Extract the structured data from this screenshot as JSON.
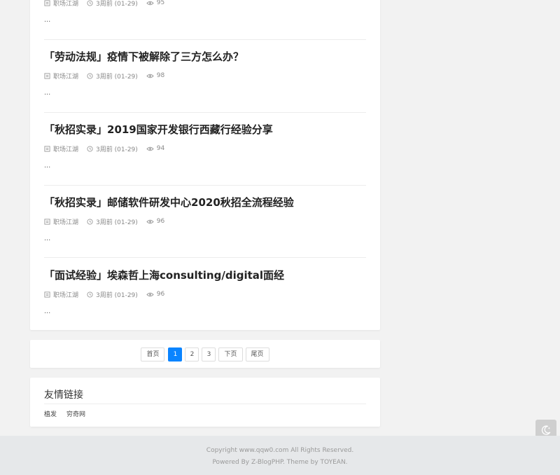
{
  "posts": [
    {
      "title": "",
      "category": "职场江湖",
      "time": "3周前 (01-29)",
      "views": "95",
      "excerpt": "..."
    },
    {
      "title": "「劳动法规」疫情下被解除了三方怎么办？",
      "category": "职场江湖",
      "time": "3周前 (01-29)",
      "views": "98",
      "excerpt": "..."
    },
    {
      "title": "「秋招实录」2019国家开发银行西藏行经验分享",
      "category": "职场江湖",
      "time": "3周前 (01-29)",
      "views": "94",
      "excerpt": "..."
    },
    {
      "title": "「秋招实录」邮储软件研发中心2020秋招全流程经验",
      "category": "职场江湖",
      "time": "3周前 (01-29)",
      "views": "96",
      "excerpt": "..."
    },
    {
      "title": "「面试经验」埃森哲上海consulting/digital面经",
      "category": "职场江湖",
      "time": "3周前 (01-29)",
      "views": "96",
      "excerpt": "..."
    }
  ],
  "pagination": {
    "first": "首页",
    "pages": [
      "1",
      "2",
      "3"
    ],
    "current": "1",
    "next": "下页",
    "last": "尾页"
  },
  "links": {
    "title": "友情链接",
    "items": [
      "植发",
      "穷奇网"
    ]
  },
  "footer": {
    "copyright": "Copyright www.qqw0.com All Rights Reserved.",
    "powered": "Powered By Z-BlogPHP. Theme by TOYEAN."
  },
  "icons": {
    "category": "category-icon",
    "time": "clock-icon",
    "views": "eye-icon",
    "night_mode": "moon-icon"
  },
  "colors": {
    "accent": "#0a84ff",
    "background": "#f2f2f2",
    "footer_bg": "#e6e8ea"
  }
}
